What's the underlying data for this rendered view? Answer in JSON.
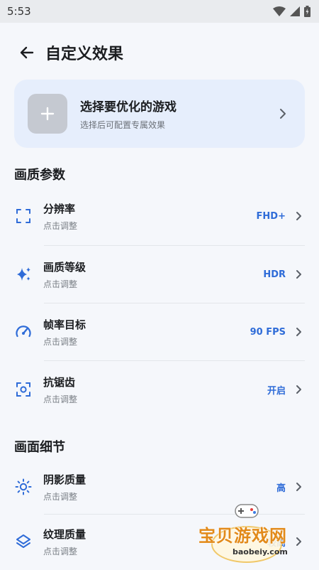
{
  "status_bar": {
    "time": "5:53"
  },
  "app_bar": {
    "title": "自定义效果"
  },
  "game_select": {
    "title": "选择要优化的游戏",
    "subtitle": "选择后可配置专属效果"
  },
  "sections": [
    {
      "title": "画质参数",
      "items": [
        {
          "title": "分辨率",
          "subtitle": "点击调整",
          "value": "FHD+",
          "icon": "fullscreen-icon"
        },
        {
          "title": "画质等级",
          "subtitle": "点击调整",
          "value": "HDR",
          "icon": "sparkle-icon"
        },
        {
          "title": "帧率目标",
          "subtitle": "点击调整",
          "value": "90 FPS",
          "icon": "speedometer-icon"
        },
        {
          "title": "抗锯齿",
          "subtitle": "点击调整",
          "value": "开启",
          "icon": "focus-icon"
        }
      ]
    },
    {
      "title": "画面细节",
      "items": [
        {
          "title": "阴影质量",
          "subtitle": "点击调整",
          "value": "高",
          "icon": "sun-icon"
        },
        {
          "title": "纹理质量",
          "subtitle": "点击调整",
          "value": "较高",
          "icon": "layers-icon"
        }
      ]
    }
  ],
  "watermark": {
    "text": "宝贝游戏网",
    "url": "baobeiy.com"
  },
  "colors": {
    "accent": "#2f6cd8",
    "card_bg": "#e6eefc",
    "page_bg": "#f5f7fb"
  }
}
